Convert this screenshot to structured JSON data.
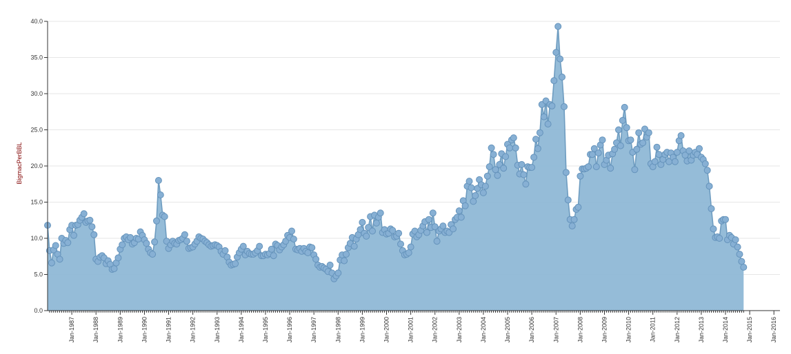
{
  "chart_data": {
    "type": "area",
    "ylabel": "BigmacPerBBL",
    "ylim": [
      0,
      40
    ],
    "y_ticks": [
      "0.0",
      "5.0",
      "10.0",
      "15.0",
      "20.0",
      "25.0",
      "30.0",
      "35.0",
      "40.0"
    ],
    "x_ticks": [
      "Jan-1987",
      "Jan-1988",
      "Jan-1989",
      "Jan-1990",
      "Jan-1991",
      "Jan-1992",
      "Jan-1993",
      "Jan-1994",
      "Jan-1995",
      "Jan-1996",
      "Jan-1997",
      "Jan-1998",
      "Jan-1999",
      "Jan-2000",
      "Jan-2001",
      "Jan-2002",
      "Jan-2003",
      "Jan-2004",
      "Jan-2005",
      "Jan-2006",
      "Jan-2007",
      "Jan-2008",
      "Jan-2009",
      "Jan-2010",
      "Jan-2011",
      "Jan-2012",
      "Jan-2013",
      "Jan-2014",
      "Jan-2015",
      "Jan-2016"
    ],
    "x_start": "1986-01",
    "grid": true,
    "fill_color": "#8fb8d6",
    "line_color": "#6e9cc0",
    "values": [
      11.8,
      8.3,
      6.6,
      8.4,
      9.0,
      7.8,
      7.1,
      10.0,
      9.3,
      9.7,
      9.4,
      11.2,
      11.8,
      10.4,
      11.8,
      11.9,
      12.5,
      12.9,
      13.4,
      12.2,
      12.4,
      12.5,
      11.6,
      10.5,
      7.1,
      6.8,
      7.4,
      7.6,
      7.3,
      6.5,
      6.9,
      6.4,
      5.7,
      5.8,
      6.6,
      7.3,
      8.5,
      9.1,
      10.0,
      10.2,
      9.8,
      10.1,
      9.2,
      9.4,
      10.0,
      9.9,
      10.9,
      10.4,
      9.8,
      9.3,
      8.5,
      8.0,
      7.8,
      9.5,
      12.4,
      18.0,
      16.0,
      13.2,
      13.0,
      9.6,
      8.6,
      9.1,
      9.6,
      9.3,
      9.2,
      9.7,
      9.8,
      10.0,
      10.5,
      9.6,
      8.6,
      8.7,
      8.8,
      9.2,
      9.6,
      10.2,
      10.0,
      9.9,
      9.6,
      9.4,
      9.1,
      8.9,
      9.0,
      9.1,
      9.0,
      8.8,
      8.2,
      7.8,
      8.3,
      7.4,
      6.7,
      6.3,
      6.4,
      6.5,
      7.4,
      8.0,
      8.5,
      8.9,
      7.7,
      8.2,
      7.9,
      7.8,
      7.8,
      8.0,
      8.3,
      8.9,
      7.6,
      7.6,
      7.8,
      7.7,
      7.9,
      8.5,
      7.6,
      9.2,
      9.0,
      8.4,
      8.8,
      9.1,
      9.6,
      10.4,
      10.1,
      11.0,
      9.9,
      8.5,
      8.4,
      8.6,
      8.2,
      8.6,
      8.2,
      8.0,
      8.8,
      8.7,
      7.7,
      7.1,
      6.3,
      6.0,
      6.1,
      5.9,
      5.7,
      5.4,
      6.3,
      5.2,
      4.4,
      4.8,
      5.2,
      7.0,
      7.7,
      6.9,
      7.8,
      8.7,
      9.3,
      10.1,
      8.9,
      9.9,
      10.5,
      11.2,
      12.2,
      10.7,
      10.3,
      11.5,
      13.0,
      11.0,
      13.2,
      12.1,
      12.9,
      13.5,
      10.8,
      11.2,
      10.6,
      10.7,
      11.3,
      11.1,
      10.2,
      10.3,
      10.7,
      9.2,
      8.3,
      7.7,
      7.8,
      8.0,
      8.8,
      10.6,
      11.0,
      10.2,
      10.5,
      11.1,
      11.7,
      12.3,
      10.8,
      12.6,
      11.5,
      13.5,
      11.6,
      9.6,
      11.0,
      11.3,
      11.7,
      10.8,
      11.0,
      10.8,
      11.9,
      11.3,
      12.6,
      12.9,
      13.8,
      12.9,
      15.2,
      14.5,
      17.2,
      17.9,
      17.0,
      15.1,
      15.9,
      16.9,
      18.1,
      17.4,
      16.3,
      17.2,
      18.6,
      19.9,
      22.5,
      21.6,
      19.5,
      18.7,
      20.2,
      21.7,
      19.7,
      21.3,
      23.0,
      22.5,
      23.6,
      23.9,
      22.5,
      20.1,
      18.9,
      20.2,
      18.8,
      17.5,
      19.9,
      19.8,
      19.8,
      21.2,
      23.7,
      22.4,
      24.6,
      28.5,
      26.8,
      29.0,
      25.8,
      28.5,
      28.3,
      31.8,
      35.7,
      39.3,
      34.8,
      32.3,
      28.2,
      19.1,
      15.3,
      12.6,
      11.7,
      12.6,
      14.0,
      14.3,
      18.6,
      19.6,
      19.6,
      19.7,
      19.9,
      21.6,
      21.6,
      22.4,
      19.9,
      21.8,
      22.9,
      23.6,
      20.2,
      20.8,
      21.5,
      19.7,
      21.7,
      22.3,
      23.2,
      25.0,
      22.8,
      26.3,
      28.1,
      25.3,
      23.5,
      23.6,
      21.9,
      19.5,
      22.3,
      24.6,
      23.0,
      23.2,
      25.1,
      24.0,
      24.6,
      20.3,
      19.9,
      20.6,
      22.6,
      21.6,
      20.2,
      20.9,
      21.6,
      21.9,
      20.6,
      21.8,
      21.2,
      20.6,
      21.9,
      23.5,
      24.2,
      22.1,
      21.5,
      20.7,
      22.1,
      20.8,
      21.5,
      21.9,
      21.6,
      22.4,
      21.2,
      20.9,
      20.3,
      19.4,
      17.2,
      14.1,
      11.3,
      10.1,
      10.2,
      10.0,
      12.4,
      12.6,
      12.6,
      9.8,
      10.4,
      10.1,
      9.2,
      9.8,
      8.8,
      7.8,
      6.8,
      6.0
    ]
  }
}
